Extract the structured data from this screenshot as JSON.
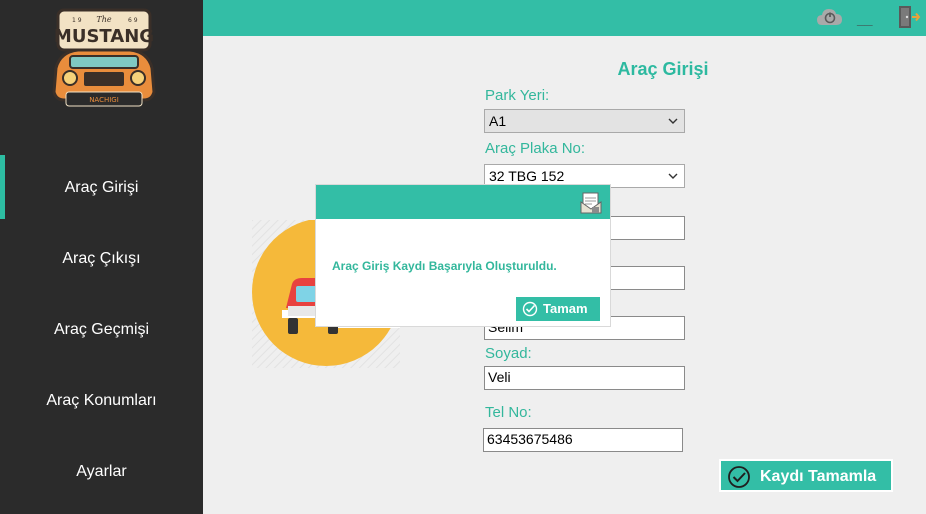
{
  "logo": {
    "line1": "The",
    "line2": "MUSTANG",
    "year_left": "1 9",
    "year_right": "6 9",
    "brand": "NACHIGI"
  },
  "sidebar": {
    "items": [
      {
        "label": "Araç Girişi",
        "active": true
      },
      {
        "label": "Araç Çıkışı"
      },
      {
        "label": "Araç Geçmişi"
      },
      {
        "label": "Araç Konumları"
      },
      {
        "label": "Ayarlar"
      }
    ]
  },
  "topbar": {
    "minimize_label": "__",
    "icons": [
      "cloud-power-icon",
      "minimize-icon",
      "exit-door-icon"
    ]
  },
  "form": {
    "title": "Araç Girişi",
    "park_yeri_label": "Park Yeri:",
    "park_yeri_value": "A1",
    "plaka_label": "Araç Plaka No:",
    "plaka_value": "32 TBG 152",
    "ad_value": "Selim",
    "soyad_label": "Soyad:",
    "soyad_value": "Veli",
    "tel_label": "Tel No:",
    "tel_value": "63453675486",
    "save_label": "Kaydı Tamamla"
  },
  "dialog": {
    "message": "Araç Giriş Kaydı Başarıyla Oluşturuldu.",
    "ok_label": "Tamam"
  },
  "colors": {
    "accent": "#33bea6",
    "sidebar": "#2b2b2b",
    "background": "#efefef",
    "text_accent": "#33b79c"
  }
}
